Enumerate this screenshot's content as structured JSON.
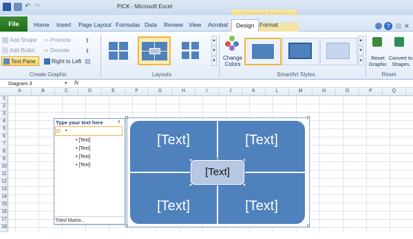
{
  "window": {
    "title": "PICK - Microsoft Excel",
    "contextual_tab_group": "SmartArt Tools"
  },
  "tabs": [
    "File",
    "Home",
    "Insert",
    "Page Layout",
    "Formulas",
    "Data",
    "Review",
    "View",
    "Acrobat",
    "Design",
    "Format"
  ],
  "active_tab": "Design",
  "ribbon": {
    "create_graphic": {
      "label": "Create Graphic",
      "add_shape": "Add Shape",
      "add_bullet": "Add Bullet",
      "text_pane": "Text Pane",
      "promote": "Promote",
      "demote": "Demote",
      "right_to_left": "Right to Left"
    },
    "layouts": {
      "label": "Layouts"
    },
    "smartart_styles": {
      "label": "SmartArt Styles",
      "change_colors": "Change Colors"
    },
    "reset": {
      "label": "Reset",
      "reset_graphic": "Reset Graphic",
      "convert_to_shapes": "Convert to Shapes"
    }
  },
  "formula_bar": {
    "name_box": "Diagram 3",
    "fx": "fx"
  },
  "columns": [
    "A",
    "B",
    "C",
    "D",
    "E",
    "F",
    "G",
    "H",
    "I",
    "J",
    "K",
    "L",
    "M",
    "N",
    "O",
    "P",
    "Q"
  ],
  "rows": [
    "1",
    "2",
    "3",
    "4",
    "5",
    "6",
    "7",
    "8",
    "9",
    "10",
    "11",
    "12",
    "13",
    "14",
    "15",
    "16",
    "17",
    "18"
  ],
  "text_pane": {
    "title": "Type your text here",
    "close": "x",
    "first_bullet": "",
    "items": [
      "[Text]",
      "[Text]",
      "[Text]",
      "[Text]"
    ],
    "footer": "Titled Matrix..."
  },
  "smartart": {
    "quadrants": [
      "[Text]",
      "[Text]",
      "[Text]",
      "[Text]"
    ],
    "center": "[Text]",
    "accent_color": "#4f81bd",
    "center_color": "#b6c7e3"
  }
}
